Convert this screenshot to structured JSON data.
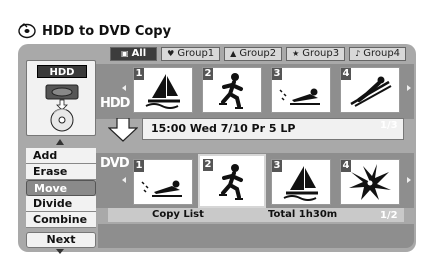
{
  "header": {
    "title": "HDD to DVD Copy",
    "icon": "disc-copy-icon"
  },
  "source_panel": {
    "label": "HDD",
    "icon": "hdd-drive-icon"
  },
  "menu": {
    "items": [
      {
        "label": "Add"
      },
      {
        "label": "Erase"
      },
      {
        "label": "Move",
        "selected": true
      },
      {
        "label": "Divide"
      },
      {
        "label": "Combine"
      }
    ],
    "next_label": "Next"
  },
  "tabs": [
    {
      "label": "All",
      "icon": "hdd-icon",
      "active": true
    },
    {
      "label": "Group1",
      "icon": "heart-icon"
    },
    {
      "label": "Group2",
      "icon": "mountain-icon"
    },
    {
      "label": "Group3",
      "icon": "star-icon"
    },
    {
      "label": "Group4",
      "icon": "music-note-icon"
    }
  ],
  "hdd_row": {
    "label": "HDD",
    "thumbnails": [
      {
        "num": "1",
        "icon": "windsurfer-icon"
      },
      {
        "num": "2",
        "icon": "skater-icon"
      },
      {
        "num": "3",
        "icon": "swimmer-icon"
      },
      {
        "num": "4",
        "icon": "ski-jumper-icon"
      }
    ],
    "page": "1/3"
  },
  "info": {
    "text": "15:00 Wed  7/10  Pr 5   LP"
  },
  "dvd_row": {
    "label": "DVD",
    "thumbnails": [
      {
        "num": "1",
        "icon": "swimmer-icon"
      },
      {
        "num": "2",
        "icon": "skater-icon",
        "selected": true
      },
      {
        "num": "3",
        "icon": "windsurfer-icon"
      },
      {
        "num": "4",
        "icon": "lily-flower-icon"
      }
    ],
    "page": "1/2"
  },
  "copy_list": {
    "label": "Copy List",
    "total": "Total  1h30m"
  },
  "colors": {
    "panel": "#a9a9a9",
    "row": "#8e8e8e",
    "active_tab": "#3c3c3c"
  }
}
